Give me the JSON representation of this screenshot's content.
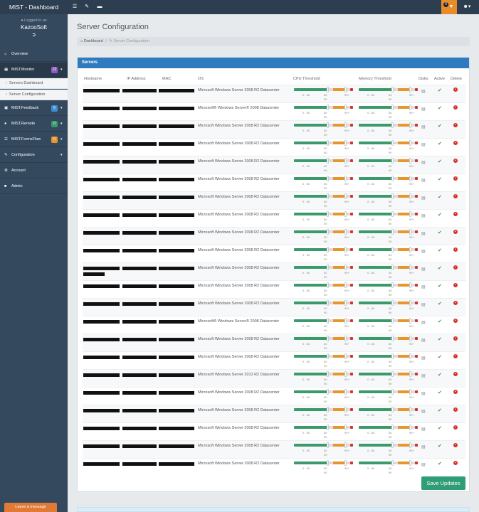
{
  "app": {
    "title": "MIST - Dashboard",
    "toolbar_icons": [
      "list-icon",
      "pencil-icon",
      "minus-icon"
    ],
    "alert_count": "0",
    "alert_icon": "bell-icon",
    "user_icon": "user-icon"
  },
  "sidebar": {
    "logged_in_as": "Logged in as",
    "org_name": "KazooSoft",
    "logout_icon": "logout-icon",
    "items": [
      {
        "label": "Overview",
        "icon": "home-icon"
      },
      {
        "label": "MIST.Monitor",
        "icon": "chart-icon",
        "badge": "22",
        "badge_color": "#8e5cc4",
        "active": true
      },
      {
        "label": "Servers Dashboard",
        "sub": true
      },
      {
        "label": "Server Configuration",
        "sub": true
      },
      {
        "label": "MIST.Feedback",
        "icon": "comment-icon",
        "badge": "6",
        "badge_color": "#3b8fd1"
      },
      {
        "label": "MIST.Remote",
        "icon": "remote-icon",
        "badge": "0",
        "badge_color": "#3a9a6c"
      },
      {
        "label": "MIST.FormsFlow",
        "icon": "forms-icon",
        "badge": "0",
        "badge_color": "#e7962c"
      },
      {
        "label": "Configuration",
        "icon": "pencil-icon"
      },
      {
        "label": "Account",
        "icon": "gear-icon"
      },
      {
        "label": "Admin",
        "icon": "lock-icon"
      }
    ],
    "leave_message": "Leave a message"
  },
  "page": {
    "title": "Server Configuration",
    "breadcrumb": [
      "Dashboard",
      "Server Configuration"
    ]
  },
  "panel": {
    "title": "Servers",
    "columns": [
      "Hostname",
      "IP Address",
      "MAC",
      "OS",
      "CPU Threshold",
      "Memory Threshold",
      "Disks",
      "Active",
      "Delete"
    ],
    "threshold_labels": [
      "0 - 60",
      "60",
      "90+",
      "90"
    ],
    "save_label": "Save Updates",
    "rows": [
      {
        "os": "Microsoft Windows Server 2008 R2 Datacenter",
        "cpu": [
          60,
          90
        ],
        "mem": [
          60,
          90
        ]
      },
      {
        "os": "Microsoft® Windows Server® 2008 Datacenter",
        "cpu": [
          60,
          90
        ],
        "mem": [
          60,
          90
        ]
      },
      {
        "os": "Microsoft Windows Server 2008 R2 Datacenter",
        "cpu": [
          60,
          90
        ],
        "mem": [
          60,
          90
        ]
      },
      {
        "os": "Microsoft Windows Server 2008 R2 Datacenter",
        "cpu": [
          60,
          90
        ],
        "mem": [
          60,
          90
        ]
      },
      {
        "os": "Microsoft Windows Server 2008 R2 Datacenter",
        "cpu": [
          60,
          90
        ],
        "mem": [
          60,
          90
        ]
      },
      {
        "os": "Microsoft Windows Server 2008 R2 Datacenter",
        "cpu": [
          60,
          90
        ],
        "mem": [
          60,
          90
        ]
      },
      {
        "os": "Microsoft Windows Server 2008 R2 Datacenter",
        "cpu": [
          60,
          90
        ],
        "mem": [
          60,
          90
        ]
      },
      {
        "os": "Microsoft Windows Server 2008 R2 Datacenter",
        "cpu": [
          60,
          90
        ],
        "mem": [
          60,
          90
        ]
      },
      {
        "os": "Microsoft Windows Server 2008 R2 Datacenter",
        "cpu": [
          60,
          90
        ],
        "mem": [
          60,
          90
        ]
      },
      {
        "os": "Microsoft Windows Server 2008 R2 Datacenter",
        "cpu": [
          60,
          90
        ],
        "mem": [
          60,
          90
        ]
      },
      {
        "os": "Microsoft Windows Server 2008 R2 Datacenter",
        "cpu": [
          60,
          90
        ],
        "mem": [
          60,
          90
        ]
      },
      {
        "os": "Microsoft Windows Server 2008 R2 Datacenter",
        "cpu": [
          60,
          90
        ],
        "mem": [
          60,
          90
        ]
      },
      {
        "os": "Microsoft Windows Server 2008 R2 Datacenter",
        "cpu": [
          60,
          90
        ],
        "mem": [
          60,
          90
        ]
      },
      {
        "os": "Microsoft® Windows Server® 2008 Datacenter",
        "cpu": [
          60,
          90
        ],
        "mem": [
          60,
          90
        ]
      },
      {
        "os": "Microsoft Windows Server 2008 R2 Datacenter",
        "cpu": [
          60,
          90
        ],
        "mem": [
          60,
          90
        ]
      },
      {
        "os": "Microsoft Windows Server 2008 R2 Datacenter",
        "cpu": [
          60,
          90
        ],
        "mem": [
          60,
          90
        ]
      },
      {
        "os": "Microsoft Windows Server 2012 R2 Datacenter",
        "cpu": [
          60,
          90
        ],
        "mem": [
          60,
          90
        ]
      },
      {
        "os": "Microsoft Windows Server 2008 R2 Datacenter",
        "cpu": [
          60,
          90
        ],
        "mem": [
          60,
          90
        ]
      },
      {
        "os": "Microsoft Windows Server 2008 R2 Datacenter",
        "cpu": [
          60,
          90
        ],
        "mem": [
          60,
          90
        ]
      },
      {
        "os": "Microsoft Windows Server 2008 R2 Datacenter",
        "cpu": [
          60,
          90
        ],
        "mem": [
          60,
          90
        ]
      },
      {
        "os": "Microsoft Windows Server 2008 R2 Datacenter",
        "cpu": [
          60,
          90
        ],
        "mem": [
          60,
          90
        ]
      },
      {
        "os": "Microsoft Windows Server 2008 R2 Datacenter",
        "cpu": [
          60,
          90
        ],
        "mem": [
          60,
          90
        ]
      }
    ]
  }
}
